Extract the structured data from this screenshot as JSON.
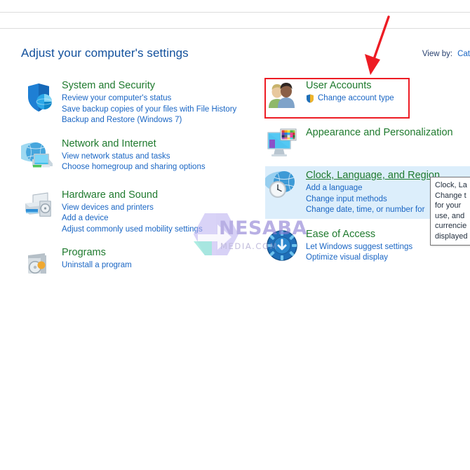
{
  "window": {
    "title": "Adjust your computer's settings"
  },
  "viewby": {
    "label": "View by:",
    "value": "Cat"
  },
  "categories": {
    "left": [
      {
        "icon": "shield-globe-icon",
        "title": "System and Security",
        "links": [
          "Review your computer's status",
          "Save backup copies of your files with File History",
          "Backup and Restore (Windows 7)"
        ]
      },
      {
        "icon": "globe-monitors-icon",
        "title": "Network and Internet",
        "links": [
          "View network status and tasks",
          "Choose homegroup and sharing options"
        ]
      },
      {
        "icon": "printer-speaker-icon",
        "title": "Hardware and Sound",
        "links": [
          "View devices and printers",
          "Add a device",
          "Adjust commonly used mobility settings"
        ]
      },
      {
        "icon": "program-disc-icon",
        "title": "Programs",
        "links": [
          "Uninstall a program"
        ]
      }
    ],
    "right": [
      {
        "icon": "two-people-icon",
        "title": "User Accounts",
        "links": [
          "Change account type"
        ],
        "link_icon": "uac-shield-icon",
        "highlighted": false
      },
      {
        "icon": "monitor-palette-icon",
        "title": "Appearance and Personalization",
        "links": [],
        "highlighted": false
      },
      {
        "icon": "globe-clock-icon",
        "title": "Clock, Language, and Region",
        "links": [
          "Add a language",
          "Change input methods",
          "Change date, time, or number for"
        ],
        "highlighted": true
      },
      {
        "icon": "ease-of-access-icon",
        "title": "Ease of Access",
        "links": [
          "Let Windows suggest settings",
          "Optimize visual display"
        ],
        "highlighted": false
      }
    ]
  },
  "tooltip": {
    "lines": [
      "Clock, La",
      "Change t",
      "for your",
      "use, and",
      "currencie",
      "displayed"
    ]
  },
  "annotations": {
    "box_color": "#ed1c24",
    "arrow_color": "#ed1c24"
  },
  "watermark": {
    "text": "NESABA",
    "subtext": "MEDIA.COM"
  }
}
